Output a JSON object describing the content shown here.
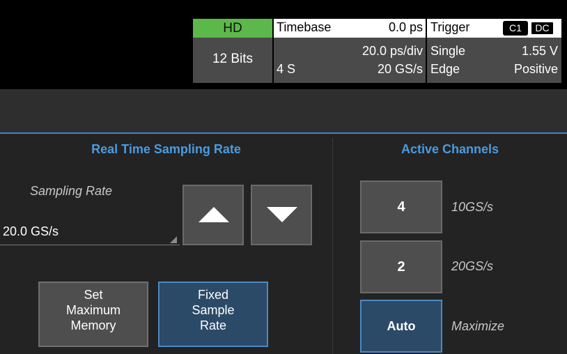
{
  "status": {
    "hd_label": "HD",
    "bits": "12 Bits",
    "timebase": {
      "title": "Timebase",
      "offset": "0.0 ps",
      "per_div": "20.0 ps/div",
      "segments": "4 S",
      "rate": "20 GS/s"
    },
    "trigger": {
      "title": "Trigger",
      "channel": "C1",
      "coupling": "DC",
      "mode": "Single",
      "level": "1.55 V",
      "type": "Edge",
      "slope": "Positive"
    }
  },
  "sampling": {
    "title": "Real Time Sampling Rate",
    "rate_label": "Sampling Rate",
    "rate_value": "20.0 GS/s",
    "up_icon": "triangle-up-icon",
    "down_icon": "triangle-down-icon",
    "set_max_memory": [
      "Set",
      "Maximum",
      "Memory"
    ],
    "fixed_sample_rate": [
      "Fixed",
      "Sample",
      "Rate"
    ],
    "selected_mode": "Fixed Sample Rate"
  },
  "channels": {
    "title": "Active Channels",
    "options": [
      {
        "label": "4",
        "note": "10GS/s"
      },
      {
        "label": "2",
        "note": "20GS/s"
      },
      {
        "label": "Auto",
        "note": "Maximize"
      }
    ],
    "selected": "Auto"
  },
  "colors": {
    "accent": "#4a9be0",
    "hd_green": "#5cb84a",
    "selected_button": "#2b4a68"
  }
}
